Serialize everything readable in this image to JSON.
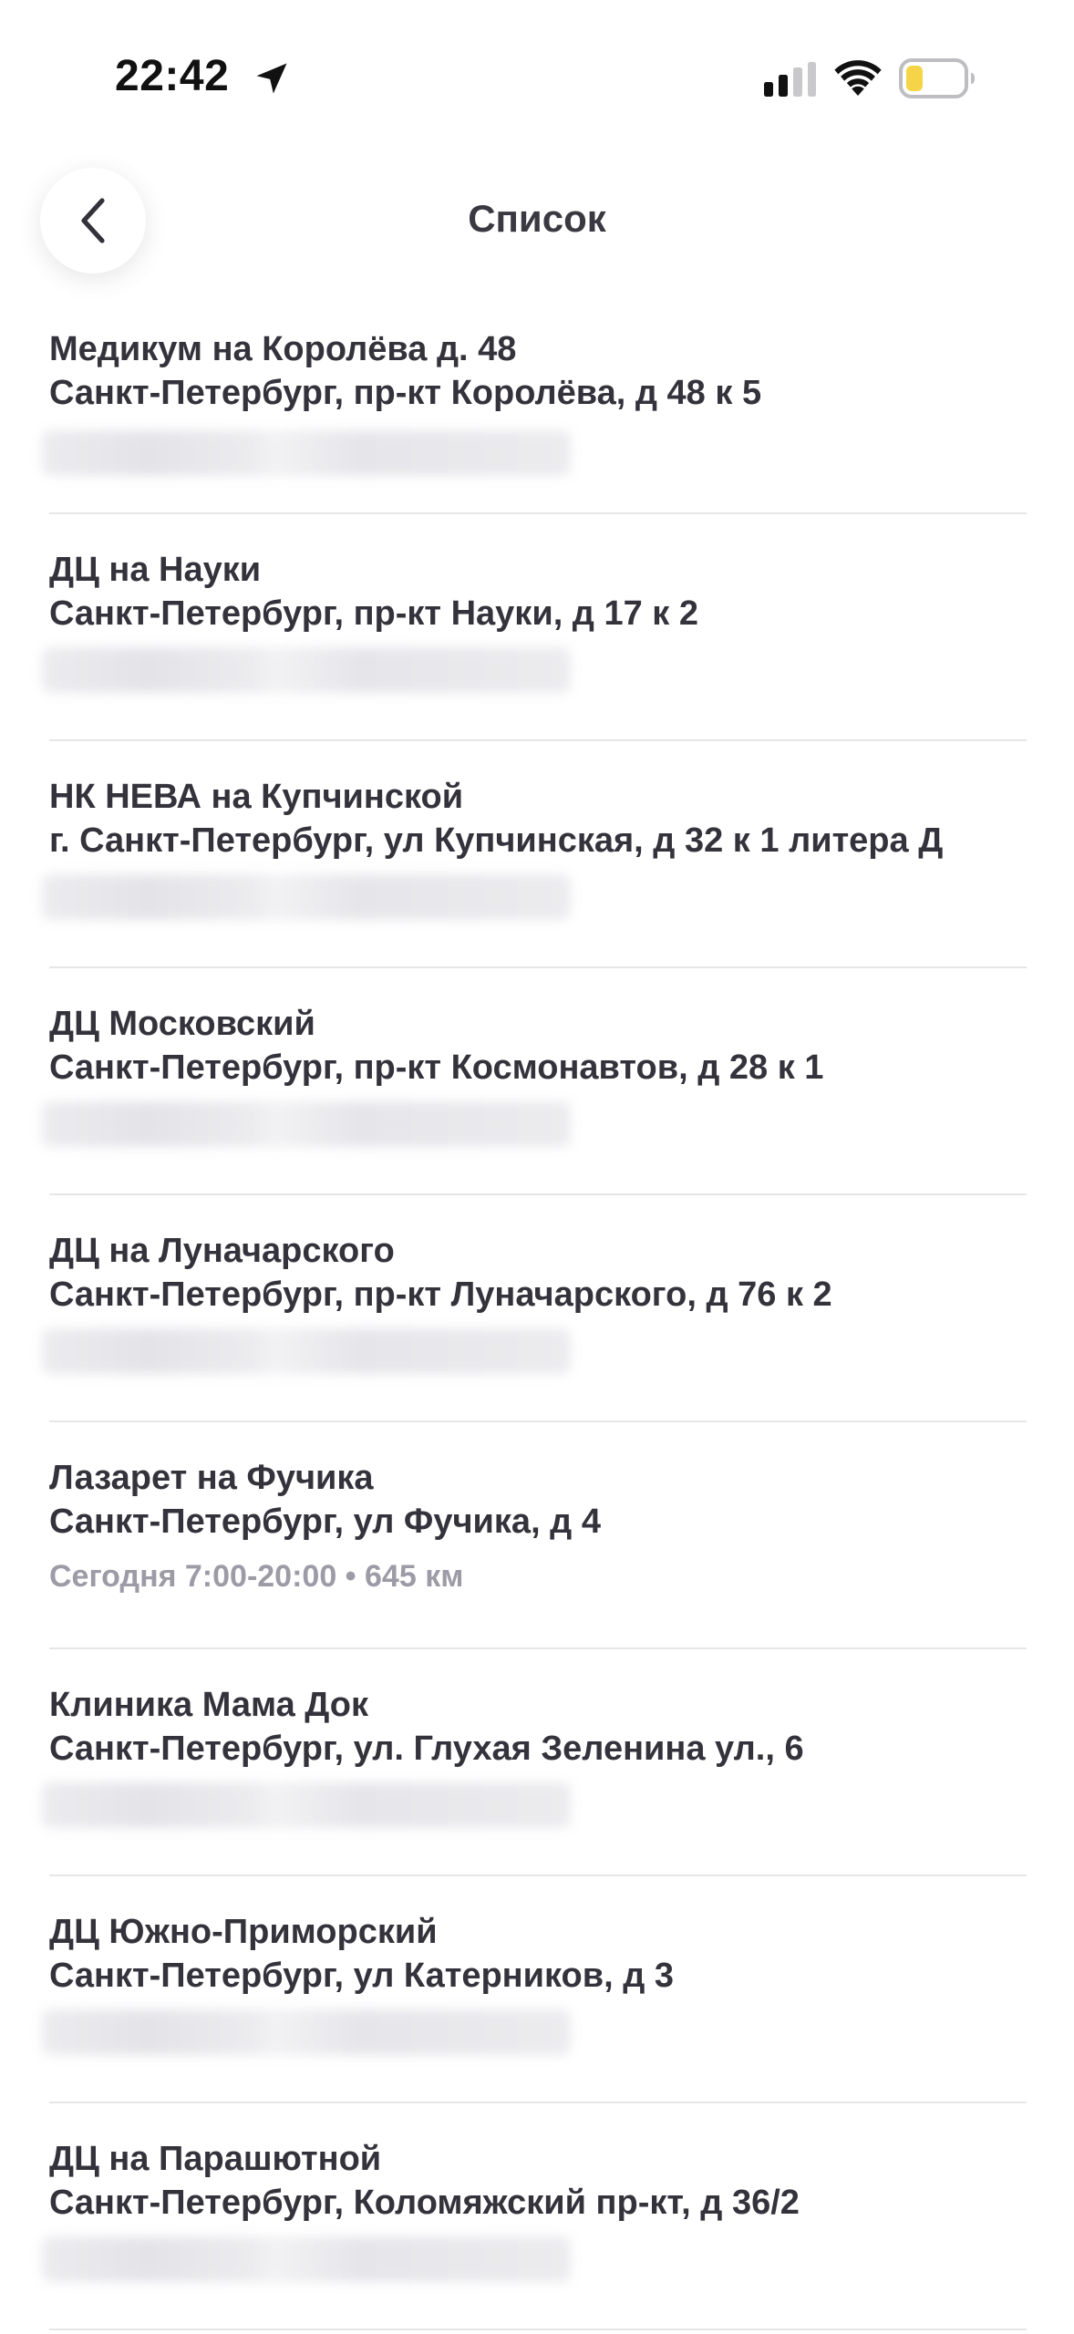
{
  "status_bar": {
    "time": "22:42",
    "icons": [
      "location-arrow-icon",
      "cellular-signal-icon",
      "wifi-icon",
      "battery-low-icon"
    ],
    "battery_color": "#f5d547"
  },
  "header": {
    "title": "Список",
    "back_icon": "chevron-left-icon"
  },
  "clinics": [
    {
      "name": "Медикум на Королёва д. 48",
      "address": "Санкт-Петербург, пр-кт Королёва, д 48 к 5",
      "schedule": "",
      "blurred": true
    },
    {
      "name": "ДЦ на Науки",
      "address": "Санкт-Петербург, пр-кт Науки, д 17 к 2",
      "schedule": "",
      "blurred": true
    },
    {
      "name": "НК НЕВА на Купчинской",
      "address": "г. Санкт-Петербург, ул Купчинская, д 32 к 1 литера Д",
      "schedule": "",
      "blurred": true
    },
    {
      "name": "ДЦ Московский",
      "address": "Санкт-Петербург, пр-кт Космонавтов, д 28 к 1",
      "schedule": "",
      "blurred": true
    },
    {
      "name": "ДЦ на Луначарского",
      "address": "Санкт-Петербург, пр-кт Луначарского, д 76 к 2",
      "schedule": "",
      "blurred": true
    },
    {
      "name": "Лазарет на Фучика",
      "address": "Санкт-Петербург, ул Фучика, д 4",
      "schedule": "Сегодня 7:00-20:00 • 645 км",
      "blurred": false
    },
    {
      "name": "Клиника Мама Док",
      "address": "Санкт-Петербург, ул. Глухая Зеленина ул., 6",
      "schedule": "",
      "blurred": true
    },
    {
      "name": "ДЦ Южно-Приморский",
      "address": "Санкт-Петербург, ул Катерников, д 3",
      "schedule": "",
      "blurred": true
    },
    {
      "name": "ДЦ на Парашютной",
      "address": "Санкт-Петербург, Коломяжский пр-кт, д 36/2",
      "schedule": "",
      "blurred": true
    }
  ]
}
